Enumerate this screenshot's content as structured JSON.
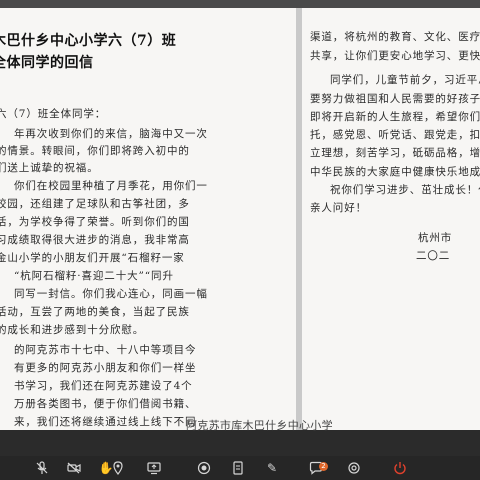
{
  "left_page": {
    "title_line1": "木巴什乡中心小学六（7）班",
    "title_line2": "全体同学的回信",
    "lines": [
      "六（7）班全体同学：",
      "年再次收到你们的来信，脑海中又一次",
      "的情景。转眼间，你们即将跨入初中的",
      "们送上诚挚的祝福。",
      "你们在校园里种植了月季花，用你们一",
      "校园，还组建了足球队和古筝社团，多",
      "活，为学校争得了荣誉。听到你们的国",
      "习成绩取得很大进步的消息，我非常高",
      "金山小学的小朋友们开展“石榴籽一家",
      "“杭阿石榴籽·喜迎二十大”“同升",
      "同写一封信。你们我心连心，同画一幅",
      "活动，互尝了两地的美食，当起了民族",
      "的成长和进步感到十分欣慰。",
      "的阿克苏市十七中、十八中等项目今",
      "有更多的阿克苏小朋友和你们一样坐",
      "书学习，我们还在阿克苏建设了4个",
      "万册各类图书，便于你们借阅书籍、",
      "来，我们还将继续通过线上线下不同"
    ],
    "caption": "阿克苏市库木巴什乡中心小学"
  },
  "right_page": {
    "lines": [
      "渠道，将杭州的教育、文化、医疗等资源",
      "共享，让你们更安心地学习、更快乐地成",
      "同学们，儿童节前夕，习近平总书记",
      "要努力做祖国和人民需要的好孩子，你们",
      "即将开启新的人生旅程，希望你们始终牢",
      "托，感党恩、听党话、跟党走，扣好人生",
      "立理想，刻苦学习，砥砺品格，增长本领",
      "中华民族的大家庭中健康快乐地成长。",
      "祝你们学习进步、茁壮成长！代向全",
      "亲人问好！",
      "杭州市",
      "二〇二"
    ]
  },
  "toolbar": {
    "icons": [
      "mic-off-icon",
      "video-off-icon",
      "hand-raise-icon",
      "location-icon",
      "share-screen-icon",
      "record-icon",
      "document-icon",
      "edit-icon",
      "chat-icon",
      "settings-icon",
      "power-icon"
    ],
    "chat_badge": "2",
    "leave_color": "#e0412d"
  }
}
